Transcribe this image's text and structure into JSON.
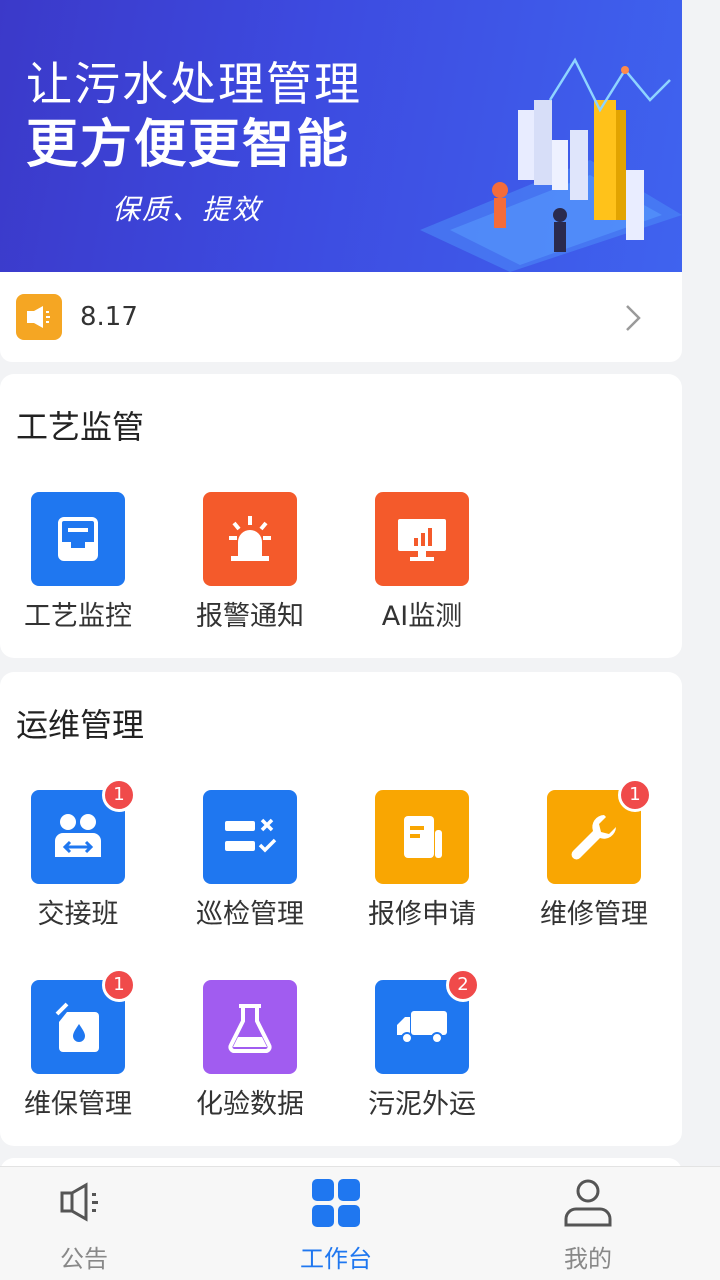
{
  "banner": {
    "title": "让污水处理管理",
    "subtitle": "更方便更智能",
    "tagline": "保质、提效"
  },
  "notice": {
    "icon": "speaker-icon",
    "text": "8.17",
    "arrow_icon": "chevron-right-icon"
  },
  "process": {
    "title": "工艺监管",
    "items": [
      {
        "label": "工艺监控",
        "icon": "inbox-tray-icon",
        "color": "#1f77f0"
      },
      {
        "label": "报警通知",
        "icon": "alarm-light-icon",
        "color": "#f45a2b"
      },
      {
        "label": "AI监测",
        "icon": "monitor-chart-icon",
        "color": "#f45a2b"
      }
    ]
  },
  "ops": {
    "title": "运维管理",
    "items": [
      {
        "label": "交接班",
        "icon": "shift-handover-icon",
        "color": "#1f77f0",
        "badge": "1"
      },
      {
        "label": "巡检管理",
        "icon": "checklist-icon",
        "color": "#1f77f0",
        "badge": ""
      },
      {
        "label": "报修申请",
        "icon": "document-icon",
        "color": "#f9a602",
        "badge": ""
      },
      {
        "label": "维修管理",
        "icon": "wrench-icon",
        "color": "#f9a602",
        "badge": "1"
      },
      {
        "label": "维保管理",
        "icon": "oil-can-icon",
        "color": "#1f77f0",
        "badge": "1"
      },
      {
        "label": "化验数据",
        "icon": "flask-icon",
        "color": "#a15cf0",
        "badge": ""
      },
      {
        "label": "污泥外运",
        "icon": "truck-icon",
        "color": "#1f77f0",
        "badge": "2"
      }
    ]
  },
  "bottom_nav": {
    "items": [
      {
        "label": "公告",
        "icon": "megaphone-icon",
        "active": false
      },
      {
        "label": "工作台",
        "icon": "grid-icon",
        "active": true
      },
      {
        "label": "我的",
        "icon": "user-icon",
        "active": false
      }
    ],
    "active_color": "#1f77f0",
    "inactive_color": "#888888"
  }
}
